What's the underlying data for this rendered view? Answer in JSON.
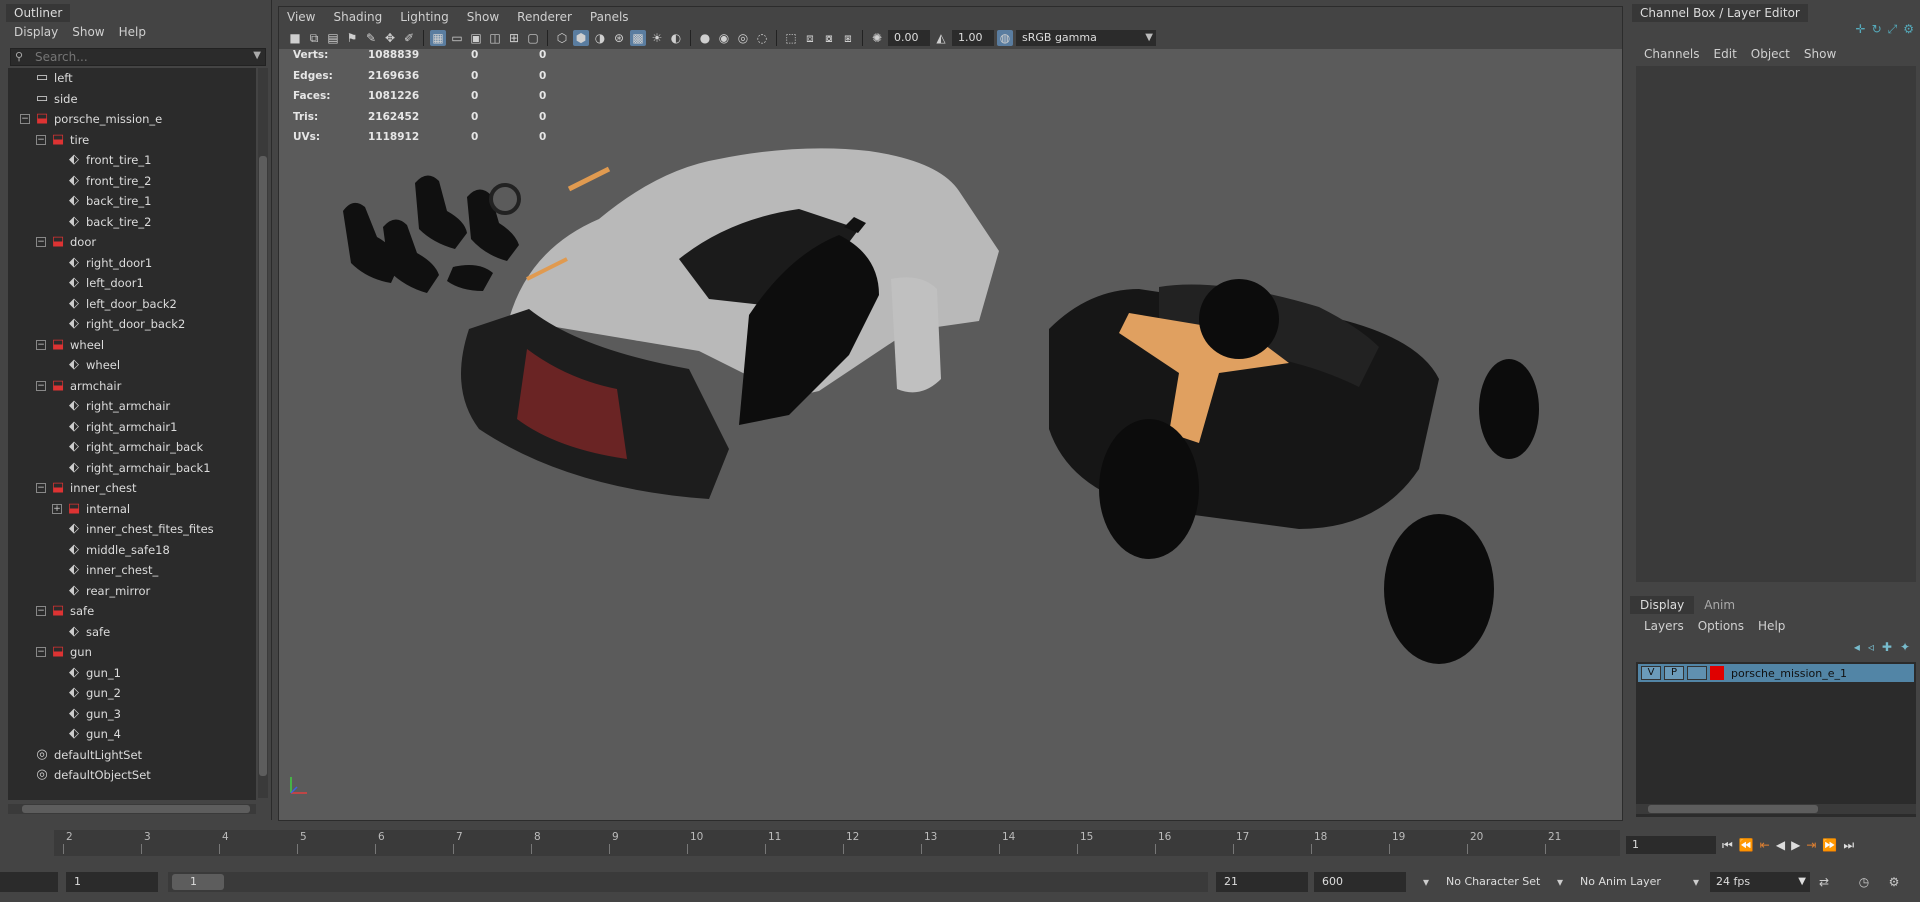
{
  "outliner": {
    "tab": "Outliner",
    "menu": [
      "Display",
      "Show",
      "Help"
    ],
    "search_placeholder": "Search...",
    "items": [
      {
        "label": "left",
        "icon": "camera",
        "depth": 1,
        "exp": ""
      },
      {
        "label": "side",
        "icon": "camera",
        "depth": 1,
        "exp": ""
      },
      {
        "label": "porsche_mission_e",
        "icon": "group",
        "depth": 1,
        "exp": "−"
      },
      {
        "label": "tire",
        "icon": "group",
        "depth": 2,
        "exp": "−"
      },
      {
        "label": "front_tire_1",
        "icon": "mesh",
        "depth": 3,
        "exp": ""
      },
      {
        "label": "front_tire_2",
        "icon": "mesh",
        "depth": 3,
        "exp": ""
      },
      {
        "label": "back_tire_1",
        "icon": "mesh",
        "depth": 3,
        "exp": ""
      },
      {
        "label": "back_tire_2",
        "icon": "mesh",
        "depth": 3,
        "exp": ""
      },
      {
        "label": "door",
        "icon": "group",
        "depth": 2,
        "exp": "−"
      },
      {
        "label": "right_door1",
        "icon": "mesh",
        "depth": 3,
        "exp": ""
      },
      {
        "label": "left_door1",
        "icon": "mesh",
        "depth": 3,
        "exp": ""
      },
      {
        "label": "left_door_back2",
        "icon": "mesh",
        "depth": 3,
        "exp": ""
      },
      {
        "label": "right_door_back2",
        "icon": "mesh",
        "depth": 3,
        "exp": ""
      },
      {
        "label": "wheel",
        "icon": "group",
        "depth": 2,
        "exp": "−"
      },
      {
        "label": "wheel",
        "icon": "mesh",
        "depth": 3,
        "exp": ""
      },
      {
        "label": "armchair",
        "icon": "group",
        "depth": 2,
        "exp": "−"
      },
      {
        "label": "right_armchair",
        "icon": "mesh",
        "depth": 3,
        "exp": ""
      },
      {
        "label": "right_armchair1",
        "icon": "mesh",
        "depth": 3,
        "exp": ""
      },
      {
        "label": "right_armchair_back",
        "icon": "mesh",
        "depth": 3,
        "exp": ""
      },
      {
        "label": "right_armchair_back1",
        "icon": "mesh",
        "depth": 3,
        "exp": ""
      },
      {
        "label": "inner_chest",
        "icon": "group",
        "depth": 2,
        "exp": "−"
      },
      {
        "label": "internal",
        "icon": "group",
        "depth": 3,
        "exp": "+"
      },
      {
        "label": "inner_chest_fites_fites",
        "icon": "mesh",
        "depth": 3,
        "exp": ""
      },
      {
        "label": "middle_safe18",
        "icon": "mesh",
        "depth": 3,
        "exp": ""
      },
      {
        "label": "inner_chest_",
        "icon": "mesh",
        "depth": 3,
        "exp": ""
      },
      {
        "label": "rear_mirror",
        "icon": "mesh",
        "depth": 3,
        "exp": ""
      },
      {
        "label": "safe",
        "icon": "group",
        "depth": 2,
        "exp": "−"
      },
      {
        "label": "safe",
        "icon": "mesh",
        "depth": 3,
        "exp": ""
      },
      {
        "label": "gun",
        "icon": "group",
        "depth": 2,
        "exp": "−"
      },
      {
        "label": "gun_1",
        "icon": "mesh",
        "depth": 3,
        "exp": ""
      },
      {
        "label": "gun_2",
        "icon": "mesh",
        "depth": 3,
        "exp": ""
      },
      {
        "label": "gun_3",
        "icon": "mesh",
        "depth": 3,
        "exp": ""
      },
      {
        "label": "gun_4",
        "icon": "mesh",
        "depth": 3,
        "exp": ""
      },
      {
        "label": "defaultLightSet",
        "icon": "set",
        "depth": 1,
        "exp": ""
      },
      {
        "label": "defaultObjectSet",
        "icon": "set",
        "depth": 1,
        "exp": ""
      }
    ]
  },
  "viewport": {
    "menu": [
      "View",
      "Shading",
      "Lighting",
      "Show",
      "Renderer",
      "Panels"
    ],
    "exposure": "0.00",
    "gamma": "1.00",
    "color_space": "sRGB gamma",
    "hud": [
      {
        "label": "Verts:",
        "v1": "1088839",
        "v2": "0",
        "v3": "0"
      },
      {
        "label": "Edges:",
        "v1": "2169636",
        "v2": "0",
        "v3": "0"
      },
      {
        "label": "Faces:",
        "v1": "1081226",
        "v2": "0",
        "v3": "0"
      },
      {
        "label": "Tris:",
        "v1": "2162452",
        "v2": "0",
        "v3": "0"
      },
      {
        "label": "UVs:",
        "v1": "1118912",
        "v2": "0",
        "v3": "0"
      }
    ]
  },
  "channel_box": {
    "tab": "Channel Box / Layer Editor",
    "menu": [
      "Channels",
      "Edit",
      "Object",
      "Show"
    ]
  },
  "layer_editor": {
    "tabs": [
      "Display",
      "Anim"
    ],
    "menu": [
      "Layers",
      "Options",
      "Help"
    ],
    "layer": {
      "v": "V",
      "p": "P",
      "name": "porsche_mission_e_1",
      "color": "#e00000"
    }
  },
  "timeline": {
    "ticks": [
      "2",
      "3",
      "4",
      "5",
      "6",
      "7",
      "8",
      "9",
      "10",
      "11",
      "12",
      "13",
      "14",
      "15",
      "16",
      "17",
      "18",
      "19",
      "20",
      "21"
    ],
    "current_frame": "1"
  },
  "range": {
    "start_field": "1",
    "thumb_label": "1",
    "end_field": "21",
    "max_field": "600",
    "character_set": "No Character Set",
    "anim_layer": "No Anim Layer",
    "fps": "24 fps"
  },
  "colors": {
    "accent": "#5285a6",
    "group_icon": "#dd3333"
  }
}
